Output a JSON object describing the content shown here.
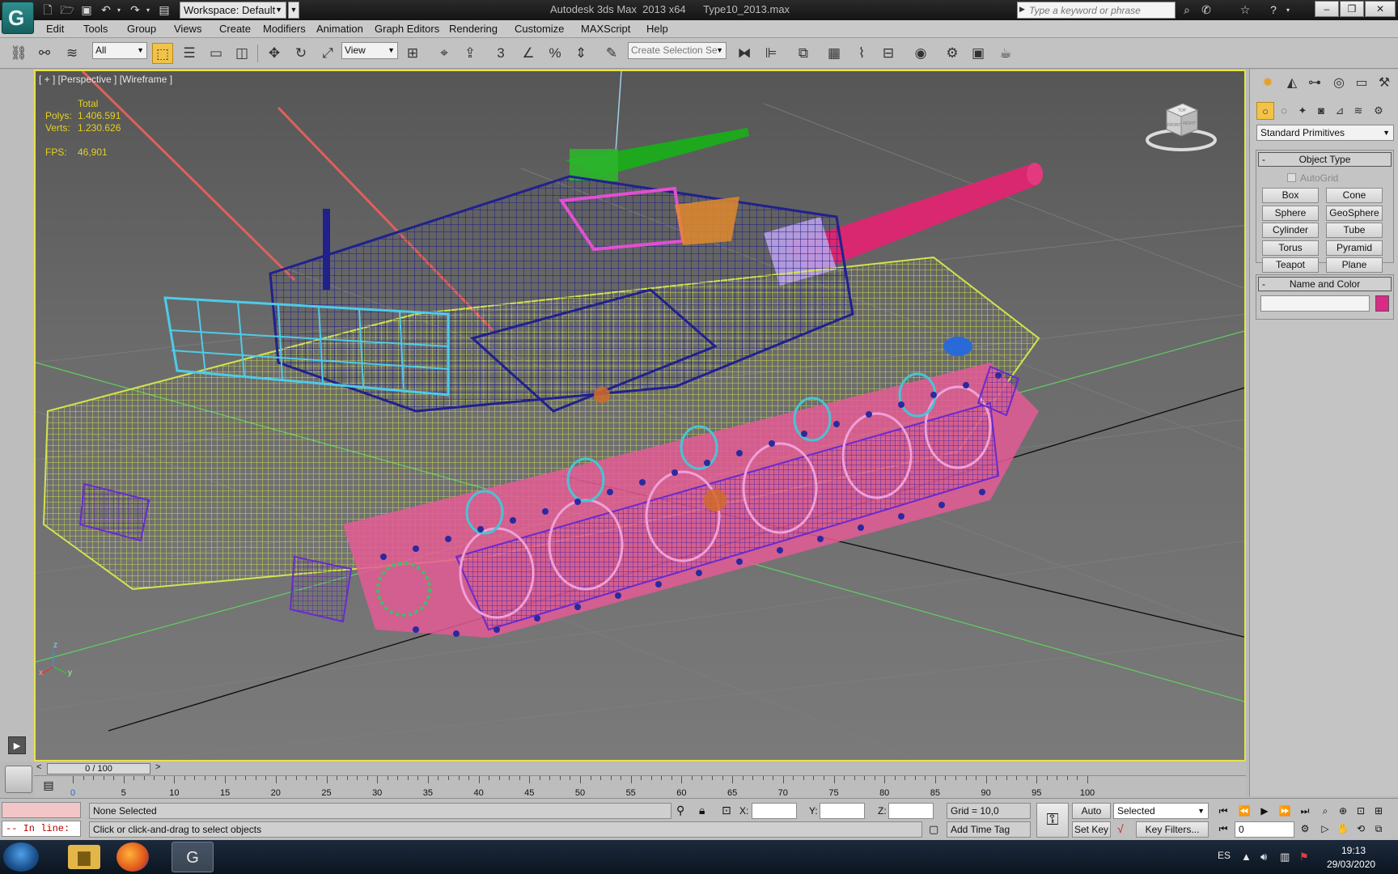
{
  "titlebar": {
    "workspace_label": "Workspace: Default",
    "window_title": "Autodesk 3ds Max  2013 x64      Type10_2013.max",
    "search_placeholder": "Type a keyword or phrase",
    "quick_access_icons": [
      "new-file-icon",
      "open-file-icon",
      "save-icon",
      "undo-icon",
      "redo-icon",
      "project-icon"
    ],
    "help_icons": [
      "binoculars-icon",
      "communication-center-icon",
      "favorites-star-icon",
      "help-icon"
    ]
  },
  "menu": [
    "Edit",
    "Tools",
    "Group",
    "Views",
    "Create",
    "Modifiers",
    "Animation",
    "Graph Editors",
    "Rendering",
    "Customize",
    "MAXScript",
    "Help"
  ],
  "toolbar": {
    "selection_filter": "All",
    "reference_coord": "View",
    "named_selection_placeholder": "Create Selection Se",
    "snap_label": "3"
  },
  "viewport": {
    "label": "[ + ] [Perspective ] [Wireframe ]",
    "stats_header": "Total",
    "polys_label": "Polys:",
    "polys_value": "1.406.591",
    "verts_label": "Verts:",
    "verts_value": "1.230.626",
    "fps_label": "FPS:",
    "fps_value": "46,901",
    "axis_x": "x",
    "axis_y": "y",
    "axis_z": "z",
    "viewcube_top": "TOP",
    "viewcube_front": "FRONT",
    "viewcube_right": "RIGHT"
  },
  "command_panel": {
    "category_dropdown": "Standard Primitives",
    "object_type_title": "Object Type",
    "autogrid_label": "AutoGrid",
    "primitives": [
      "Box",
      "Cone",
      "Sphere",
      "GeoSphere",
      "Cylinder",
      "Tube",
      "Torus",
      "Pyramid",
      "Teapot",
      "Plane"
    ],
    "name_color_title": "Name and Color",
    "object_color": "#d92a86"
  },
  "timeline": {
    "slider_label": "0 / 100",
    "ticks": [
      "0",
      "5",
      "10",
      "15",
      "20",
      "25",
      "30",
      "35",
      "40",
      "45",
      "50",
      "55",
      "60",
      "65",
      "70",
      "75",
      "80",
      "85",
      "90",
      "95",
      "100"
    ]
  },
  "statusbar": {
    "maxscript_prompt": "-- In line:",
    "selection_status": "None Selected",
    "prompt_text": "Click or click-and-drag to select objects",
    "x_label": "X:",
    "y_label": "Y:",
    "z_label": "Z:",
    "grid_label": "Grid = 10,0",
    "add_time_tag": "Add Time Tag",
    "auto_key": "Auto Key",
    "set_key": "Set Key",
    "key_mode": "Selected",
    "key_filters": "Key Filters...",
    "current_frame": "0"
  },
  "taskbar": {
    "language": "ES",
    "time": "19:13",
    "date": "29/03/2020"
  }
}
